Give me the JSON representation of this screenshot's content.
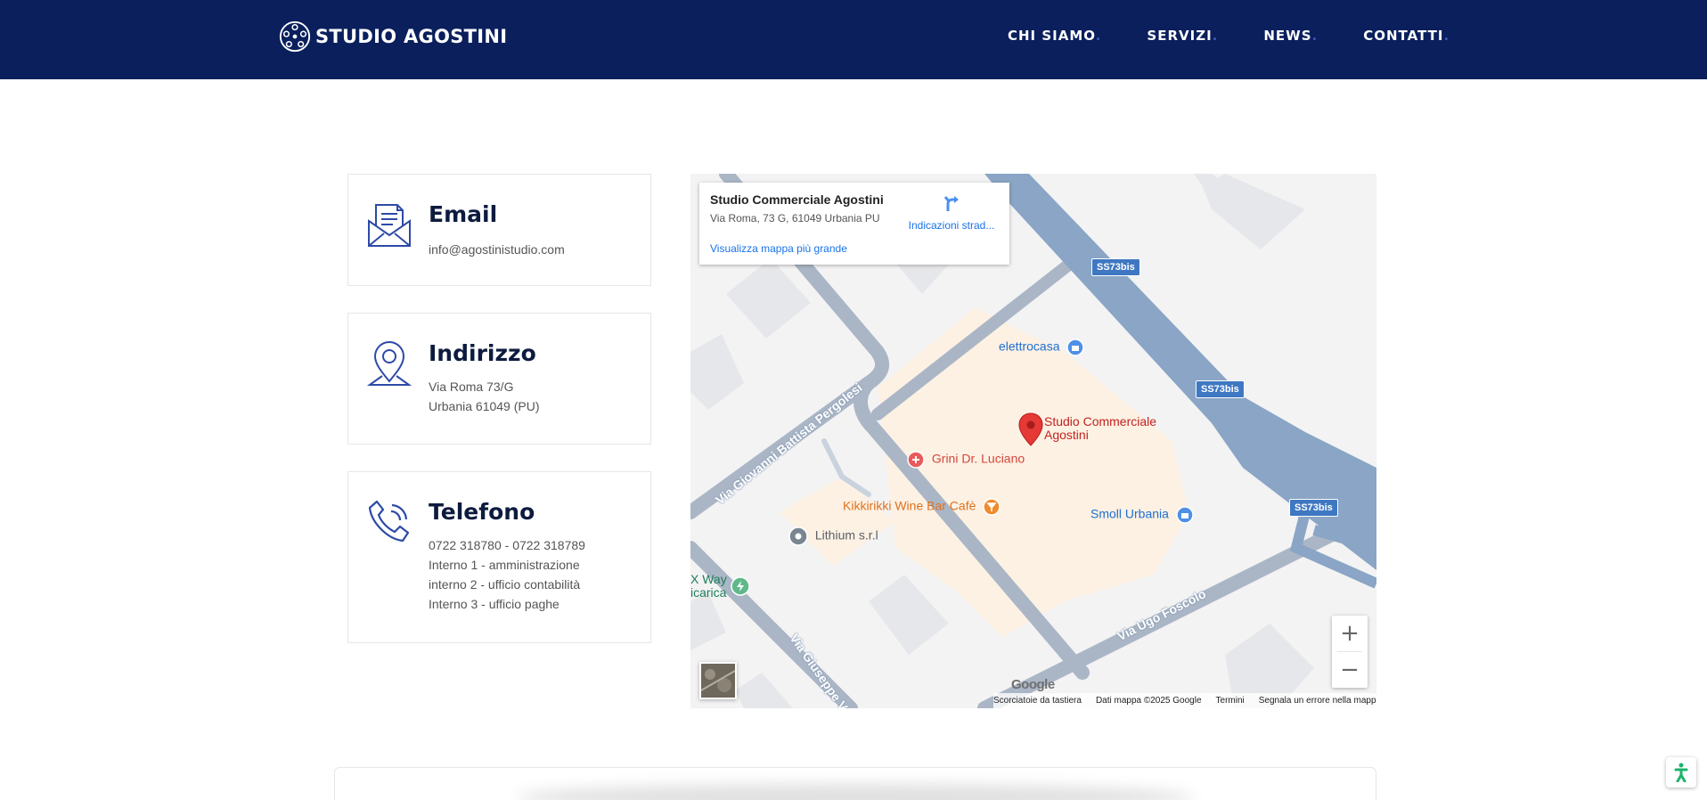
{
  "brand": {
    "name": "STUDIO AGOSTINI",
    "logo_icon": "network-circle-logo"
  },
  "nav": {
    "items": [
      {
        "label": "CHI SIAMO",
        "dot": "."
      },
      {
        "label": "SERVIZI",
        "dot": "."
      },
      {
        "label": "NEWS",
        "dot": "."
      },
      {
        "label": "CONTATTI",
        "dot": "."
      }
    ]
  },
  "contacts": {
    "email": {
      "title": "Email",
      "icon": "envelope-icon",
      "lines": [
        "info@agostinistudio.com"
      ]
    },
    "address": {
      "title": "Indirizzo",
      "icon": "map-pin-icon",
      "lines": [
        "Via Roma 73/G",
        "Urbania 61049 (PU)"
      ]
    },
    "phone": {
      "title": "Telefono",
      "icon": "phone-icon",
      "lines": [
        "0722 318780 - 0722 318789",
        "Interno 1 - amministrazione",
        "interno 2 - ufficio contabilità",
        "Interno 3 - ufficio paghe"
      ]
    }
  },
  "map": {
    "info": {
      "title": "Studio Commerciale Agostini",
      "address": "Via Roma, 73 G, 61049 Urbania PU",
      "larger_map": "Visualizza mappa più grande",
      "directions": "Indicazioni strad..."
    },
    "places": {
      "marker_line1": "Studio Commerciale",
      "marker_line2": "Agostini",
      "elettrocasa": "elettrocasa",
      "grini": "Grini Dr. Luciano",
      "kikkirikki": "Kikkirikki Wine Bar Cafè",
      "lithium": "Lithium s.r.l",
      "smoll": "Smoll Urbania",
      "xway1": "X Way",
      "xway2": "icarica"
    },
    "roads": {
      "shield": "SS73bis",
      "pergolesi": "Via Giovanni Battista Pergolesi",
      "foscolo": "Via Ugo Foscolo",
      "giuseppe": "Via Giuseppe V"
    },
    "attribution": {
      "shortcuts": "Scorciatoie da tastiera",
      "data": "Dati mappa ©2025 Google",
      "terms": "Termini",
      "report": "Segnala un errore nella mappa"
    },
    "google": "Google",
    "zoom_in": "+",
    "zoom_out": "−",
    "colors": {
      "major_road": "#8aa5c5",
      "minor_road": "#aab6c6",
      "building": "#e6e7ea",
      "poi_area": "#fcf1e3",
      "marker": "#e53935",
      "shield": "#3f78c2"
    }
  },
  "colors": {
    "header_bg": "#0a1f5c",
    "icon_blue": "#2d4aa6",
    "title_dark": "#0d1b3e"
  }
}
